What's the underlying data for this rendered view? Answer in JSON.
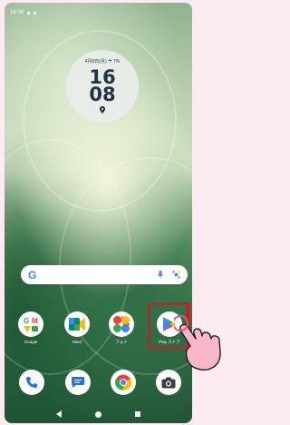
{
  "status_bar": {
    "time": "16:08"
  },
  "clock_widget": {
    "date": "4月8日(月) ☂ 7%",
    "hour": "16",
    "minute": "08"
  },
  "search_bar": {
    "logo": "G",
    "icons": [
      "mic-icon",
      "lens-icon"
    ]
  },
  "apps": [
    {
      "label": "Google",
      "icon": "google-folder-icon"
    },
    {
      "label": "Meet",
      "icon": "meet-icon"
    },
    {
      "label": "フォト",
      "icon": "photos-icon"
    },
    {
      "label": "Play ストア",
      "icon": "play-store-icon",
      "highlighted": true
    }
  ],
  "dock": [
    {
      "icon": "phone-icon"
    },
    {
      "icon": "messages-icon"
    },
    {
      "icon": "chrome-icon"
    },
    {
      "icon": "camera-icon"
    }
  ],
  "colors": {
    "page_background": "#fcebf1",
    "highlight_border": "#d5191f",
    "hand": "#f7b7c6"
  }
}
